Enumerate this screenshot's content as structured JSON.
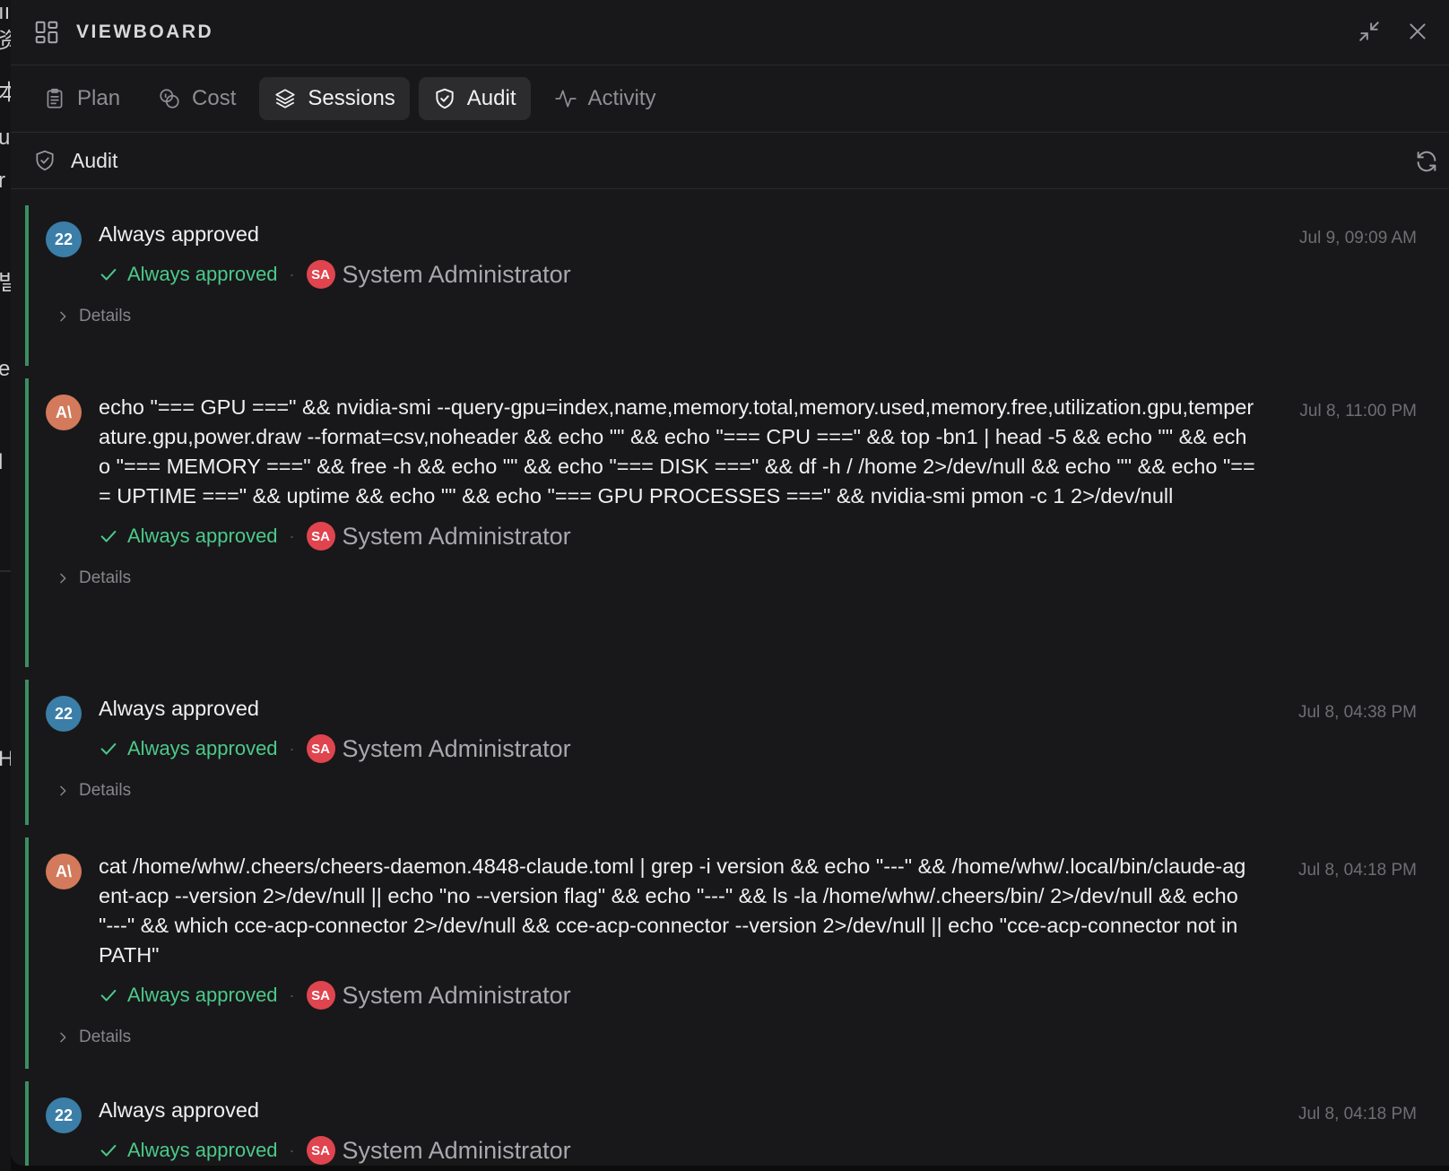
{
  "window": {
    "title": "VIEWBOARD"
  },
  "tabs": [
    {
      "label": "Plan",
      "icon": "clipboard-icon"
    },
    {
      "label": "Cost",
      "icon": "coins-icon"
    },
    {
      "label": "Sessions",
      "icon": "layers-icon"
    },
    {
      "label": "Audit",
      "icon": "shield-icon"
    },
    {
      "label": "Activity",
      "icon": "activity-icon"
    }
  ],
  "section": {
    "title": "Audit"
  },
  "entries": [
    {
      "avatar": "22",
      "avatar_type": "number",
      "text": "Always approved",
      "time": "Jul 9, 09:09 AM",
      "status": "Always approved",
      "user_initials": "SA",
      "user": "System Administrator",
      "details_label": "Details"
    },
    {
      "avatar": "A\\",
      "avatar_type": "anthropic",
      "text": "echo \"=== GPU ===\" && nvidia-smi --query-gpu=index,name,memory.total,memory.used,memory.free,utilization.gpu,temperature.gpu,power.draw --format=csv,noheader && echo \"\" && echo \"=== CPU ===\" && top -bn1 | head -5 && echo \"\" && echo \"=== MEMORY ===\" && free -h && echo \"\" && echo \"=== DISK ===\" && df -h / /home 2>/dev/null && echo \"\" && echo \"=== UPTIME ===\" && uptime && echo \"\" && echo \"=== GPU PROCESSES ===\" && nvidia-smi pmon -c 1 2>/dev/null",
      "time": "Jul 8, 11:00 PM",
      "status": "Always approved",
      "user_initials": "SA",
      "user": "System Administrator",
      "details_label": "Details"
    },
    {
      "avatar": "22",
      "avatar_type": "number",
      "text": "Always approved",
      "time": "Jul 8, 04:38 PM",
      "status": "Always approved",
      "user_initials": "SA",
      "user": "System Administrator",
      "details_label": "Details"
    },
    {
      "avatar": "A\\",
      "avatar_type": "anthropic",
      "text": "cat /home/whw/.cheers/cheers-daemon.4848-claude.toml | grep -i version && echo \"---\" && /home/whw/.local/bin/claude-agent-acp --version 2>/dev/null || echo \"no --version flag\" && echo \"---\" && ls -la /home/whw/.cheers/bin/ 2>/dev/null && echo \"---\" && which cce-acp-connector 2>/dev/null && cce-acp-connector --version 2>/dev/null || echo \"cce-acp-connector not in PATH\"",
      "time": "Jul 8, 04:18 PM",
      "status": "Always approved",
      "user_initials": "SA",
      "user": "System Administrator",
      "details_label": "Details"
    },
    {
      "avatar": "22",
      "avatar_type": "number",
      "text": "Always approved",
      "time": "Jul 8, 04:18 PM",
      "status": "Always approved",
      "user_initials": "SA",
      "user": "System Administrator",
      "details_label": ""
    }
  ],
  "background_app": {
    "fragments": [
      "资",
      "本",
      "u",
      "r",
      "빌",
      "e",
      "l",
      "H="
    ]
  },
  "colors": {
    "panel": "#18181a",
    "accent_green": "#4cc98a",
    "entry_border": "#3a8f62",
    "number_avatar": "#3b7ea8",
    "anthropic_avatar": "#d27a5b",
    "user_avatar": "#e0444e"
  }
}
